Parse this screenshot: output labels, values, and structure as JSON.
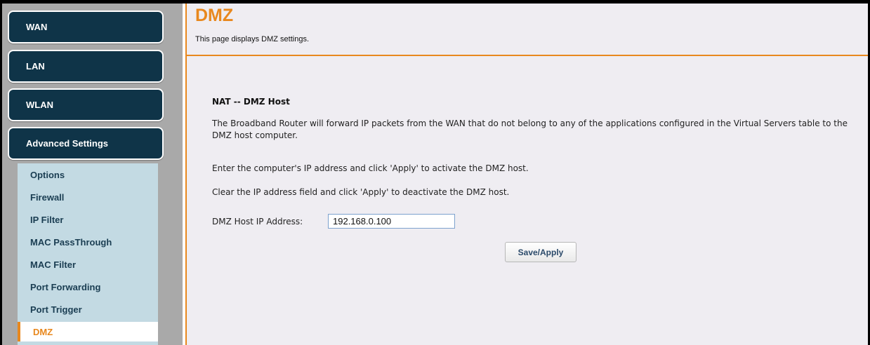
{
  "sidebar": {
    "menu": [
      {
        "label": "WAN"
      },
      {
        "label": "LAN"
      },
      {
        "label": "WLAN"
      },
      {
        "label": "Advanced Settings"
      }
    ],
    "submenu": [
      {
        "label": "Options"
      },
      {
        "label": "Firewall"
      },
      {
        "label": "IP Filter"
      },
      {
        "label": "MAC PassThrough"
      },
      {
        "label": "MAC Filter"
      },
      {
        "label": "Port Forwarding"
      },
      {
        "label": "Port Trigger"
      },
      {
        "label": "DMZ"
      }
    ],
    "active_item": "DMZ"
  },
  "header": {
    "title": "DMZ",
    "subtitle": "This page displays DMZ settings."
  },
  "content": {
    "section_title": "NAT -- DMZ Host",
    "paragraph1": "The Broadband Router will forward IP packets from the WAN that do not belong to any of the applications configured in the Virtual Servers table to the DMZ host computer.",
    "paragraph2": "Enter the computer's IP address and click 'Apply' to activate the DMZ host.",
    "paragraph3": "Clear the IP address field and click 'Apply' to deactivate the DMZ host.",
    "ip_label": "DMZ Host IP Address:",
    "ip_value": "192.168.0.100",
    "save_button": "Save/Apply"
  },
  "colors": {
    "accent": "#e8881e",
    "menu_bg": "#0f3448",
    "submenu_bg": "#c3dae3",
    "content_bg": "#efedf2"
  }
}
